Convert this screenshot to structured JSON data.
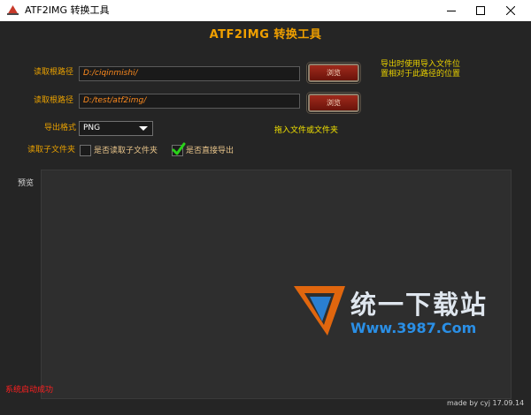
{
  "window": {
    "title": "ATF2IMG 转换工具"
  },
  "app": {
    "title": "ATF2IMG 转换工具"
  },
  "form": {
    "read_path_1": {
      "label": "读取根路径",
      "value": "D:/ciqinmishi/",
      "button": "浏览"
    },
    "read_path_2": {
      "label": "读取根路径",
      "value": "D:/test/atf2img/",
      "button": "浏览"
    },
    "export_note": "导出时使用导入文件位置相对于此路径的位置",
    "export_format": {
      "label": "导出格式",
      "selected": "PNG"
    },
    "drag_hint": "拖入文件或文件夹",
    "subfolder": {
      "label": "读取子文件夹",
      "read_subfolders": {
        "label": "是否读取子文件夹",
        "checked": false
      },
      "direct_export": {
        "label": "是否直接导出",
        "checked": true
      }
    }
  },
  "preview": {
    "label": "预览"
  },
  "status": {
    "text": "系统启动成功",
    "credit": "made by cyj 17.09.14"
  },
  "watermark": {
    "text": "统一下载站",
    "url": "Www.3987.Com"
  },
  "colors": {
    "accent": "#f0a000",
    "background": "#252525",
    "status": "#ff2020"
  }
}
